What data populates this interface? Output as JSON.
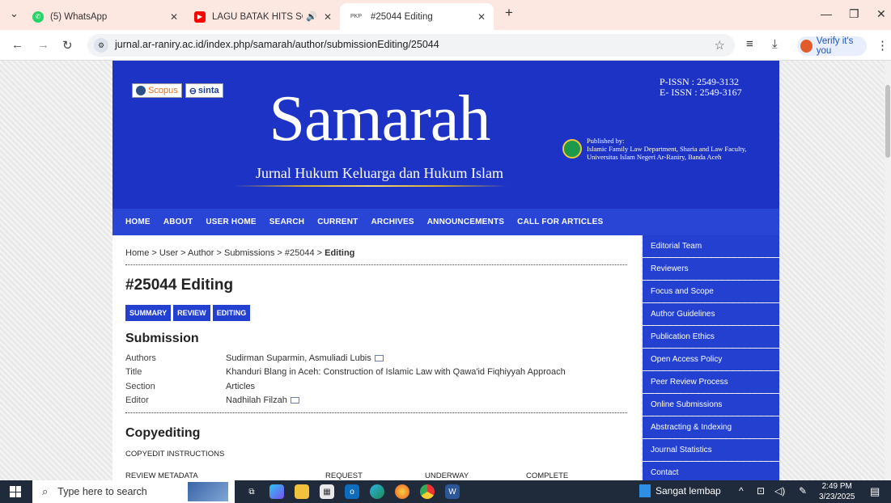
{
  "browser": {
    "tabs": [
      {
        "label": "(5) WhatsApp",
        "icon": "whatsapp-icon",
        "color": "#25d366",
        "glyph": "✆"
      },
      {
        "label": "LAGU BATAK HITS SOUND \\",
        "icon": "youtube-icon",
        "color": "#ff0000",
        "glyph": "▶"
      },
      {
        "label": "#25044 Editing",
        "icon": "pkp-icon",
        "color": "#444444",
        "glyph": "PKP"
      }
    ],
    "url": "jurnal.ar-raniry.ac.id/index.php/samarah/author/submissionEditing/25044",
    "profile_button": "Verify it's you"
  },
  "header": {
    "badges": [
      "Scopus",
      "sinta"
    ],
    "title": "Samarah",
    "tagline": "Jurnal Hukum Keluarga dan Hukum Islam",
    "p_issn": "P-ISSN   : 2549-3132",
    "e_issn": "E- ISSN  : 2549-3167",
    "published_by": "Published by:",
    "publisher_line1": "Islamic Family Law Department, Sharia and Law Faculty,",
    "publisher_line2": "Universitas Islam Negeri Ar-Raniry, Banda Aceh"
  },
  "nav": [
    "HOME",
    "ABOUT",
    "USER HOME",
    "SEARCH",
    "CURRENT",
    "ARCHIVES",
    "ANNOUNCEMENTS",
    "CALL FOR ARTICLES"
  ],
  "breadcrumb": {
    "path": "Home > User > Author > Submissions > #25044 > ",
    "current": "Editing"
  },
  "page_title": "#25044 Editing",
  "subtabs": [
    "SUMMARY",
    "REVIEW",
    "EDITING"
  ],
  "submission": {
    "heading": "Submission",
    "rows": [
      {
        "label": "Authors",
        "value": "Sudirman Suparmin, Asmuliadi Lubis",
        "mail": true
      },
      {
        "label": "Title",
        "value": "Khanduri Blang in Aceh: Construction of Islamic Law with Qawa'id Fiqhiyyah Approach",
        "mail": false
      },
      {
        "label": "Section",
        "value": "Articles",
        "mail": false
      },
      {
        "label": "Editor",
        "value": "Nadhilah Filzah",
        "mail": true
      }
    ]
  },
  "copyediting": {
    "heading": "Copyediting",
    "instructions": "COPYEDIT INSTRUCTIONS",
    "review_metadata": "REVIEW METADATA",
    "columns": [
      "REQUEST",
      "UNDERWAY",
      "COMPLETE"
    ]
  },
  "sidebar": [
    "Editorial Team",
    "Reviewers",
    "Focus and Scope",
    "Author Guidelines",
    "Publication Ethics",
    "Open Access Policy",
    "Peer Review Process",
    "Online Submissions",
    "Abstracting & Indexing",
    "Journal Statistics",
    "Contact"
  ],
  "taskbar": {
    "search_placeholder": "Type here to search",
    "weather": "Sangat lembap",
    "time": "2:49 PM",
    "date": "3/23/2025"
  }
}
